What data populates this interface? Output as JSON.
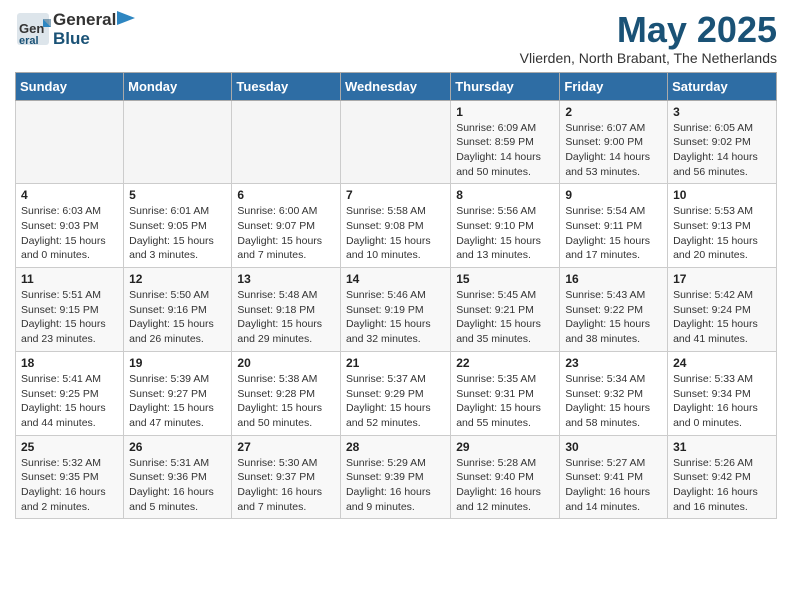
{
  "header": {
    "logo_general": "General",
    "logo_blue": "Blue",
    "month_title": "May 2025",
    "location": "Vlierden, North Brabant, The Netherlands"
  },
  "weekdays": [
    "Sunday",
    "Monday",
    "Tuesday",
    "Wednesday",
    "Thursday",
    "Friday",
    "Saturday"
  ],
  "weeks": [
    [
      {
        "day": "",
        "info": ""
      },
      {
        "day": "",
        "info": ""
      },
      {
        "day": "",
        "info": ""
      },
      {
        "day": "",
        "info": ""
      },
      {
        "day": "1",
        "info": "Sunrise: 6:09 AM\nSunset: 8:59 PM\nDaylight: 14 hours\nand 50 minutes."
      },
      {
        "day": "2",
        "info": "Sunrise: 6:07 AM\nSunset: 9:00 PM\nDaylight: 14 hours\nand 53 minutes."
      },
      {
        "day": "3",
        "info": "Sunrise: 6:05 AM\nSunset: 9:02 PM\nDaylight: 14 hours\nand 56 minutes."
      }
    ],
    [
      {
        "day": "4",
        "info": "Sunrise: 6:03 AM\nSunset: 9:03 PM\nDaylight: 15 hours\nand 0 minutes."
      },
      {
        "day": "5",
        "info": "Sunrise: 6:01 AM\nSunset: 9:05 PM\nDaylight: 15 hours\nand 3 minutes."
      },
      {
        "day": "6",
        "info": "Sunrise: 6:00 AM\nSunset: 9:07 PM\nDaylight: 15 hours\nand 7 minutes."
      },
      {
        "day": "7",
        "info": "Sunrise: 5:58 AM\nSunset: 9:08 PM\nDaylight: 15 hours\nand 10 minutes."
      },
      {
        "day": "8",
        "info": "Sunrise: 5:56 AM\nSunset: 9:10 PM\nDaylight: 15 hours\nand 13 minutes."
      },
      {
        "day": "9",
        "info": "Sunrise: 5:54 AM\nSunset: 9:11 PM\nDaylight: 15 hours\nand 17 minutes."
      },
      {
        "day": "10",
        "info": "Sunrise: 5:53 AM\nSunset: 9:13 PM\nDaylight: 15 hours\nand 20 minutes."
      }
    ],
    [
      {
        "day": "11",
        "info": "Sunrise: 5:51 AM\nSunset: 9:15 PM\nDaylight: 15 hours\nand 23 minutes."
      },
      {
        "day": "12",
        "info": "Sunrise: 5:50 AM\nSunset: 9:16 PM\nDaylight: 15 hours\nand 26 minutes."
      },
      {
        "day": "13",
        "info": "Sunrise: 5:48 AM\nSunset: 9:18 PM\nDaylight: 15 hours\nand 29 minutes."
      },
      {
        "day": "14",
        "info": "Sunrise: 5:46 AM\nSunset: 9:19 PM\nDaylight: 15 hours\nand 32 minutes."
      },
      {
        "day": "15",
        "info": "Sunrise: 5:45 AM\nSunset: 9:21 PM\nDaylight: 15 hours\nand 35 minutes."
      },
      {
        "day": "16",
        "info": "Sunrise: 5:43 AM\nSunset: 9:22 PM\nDaylight: 15 hours\nand 38 minutes."
      },
      {
        "day": "17",
        "info": "Sunrise: 5:42 AM\nSunset: 9:24 PM\nDaylight: 15 hours\nand 41 minutes."
      }
    ],
    [
      {
        "day": "18",
        "info": "Sunrise: 5:41 AM\nSunset: 9:25 PM\nDaylight: 15 hours\nand 44 minutes."
      },
      {
        "day": "19",
        "info": "Sunrise: 5:39 AM\nSunset: 9:27 PM\nDaylight: 15 hours\nand 47 minutes."
      },
      {
        "day": "20",
        "info": "Sunrise: 5:38 AM\nSunset: 9:28 PM\nDaylight: 15 hours\nand 50 minutes."
      },
      {
        "day": "21",
        "info": "Sunrise: 5:37 AM\nSunset: 9:29 PM\nDaylight: 15 hours\nand 52 minutes."
      },
      {
        "day": "22",
        "info": "Sunrise: 5:35 AM\nSunset: 9:31 PM\nDaylight: 15 hours\nand 55 minutes."
      },
      {
        "day": "23",
        "info": "Sunrise: 5:34 AM\nSunset: 9:32 PM\nDaylight: 15 hours\nand 58 minutes."
      },
      {
        "day": "24",
        "info": "Sunrise: 5:33 AM\nSunset: 9:34 PM\nDaylight: 16 hours\nand 0 minutes."
      }
    ],
    [
      {
        "day": "25",
        "info": "Sunrise: 5:32 AM\nSunset: 9:35 PM\nDaylight: 16 hours\nand 2 minutes."
      },
      {
        "day": "26",
        "info": "Sunrise: 5:31 AM\nSunset: 9:36 PM\nDaylight: 16 hours\nand 5 minutes."
      },
      {
        "day": "27",
        "info": "Sunrise: 5:30 AM\nSunset: 9:37 PM\nDaylight: 16 hours\nand 7 minutes."
      },
      {
        "day": "28",
        "info": "Sunrise: 5:29 AM\nSunset: 9:39 PM\nDaylight: 16 hours\nand 9 minutes."
      },
      {
        "day": "29",
        "info": "Sunrise: 5:28 AM\nSunset: 9:40 PM\nDaylight: 16 hours\nand 12 minutes."
      },
      {
        "day": "30",
        "info": "Sunrise: 5:27 AM\nSunset: 9:41 PM\nDaylight: 16 hours\nand 14 minutes."
      },
      {
        "day": "31",
        "info": "Sunrise: 5:26 AM\nSunset: 9:42 PM\nDaylight: 16 hours\nand 16 minutes."
      }
    ]
  ]
}
